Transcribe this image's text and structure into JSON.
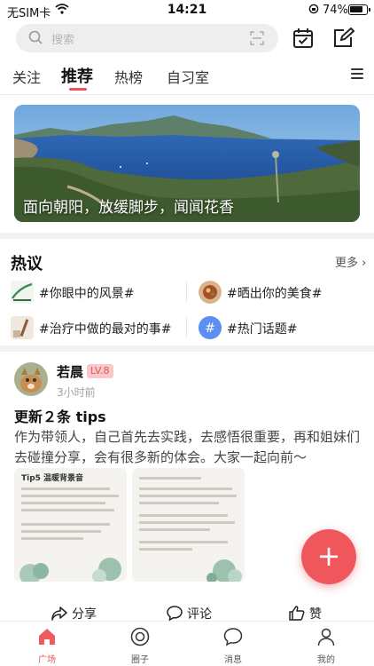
{
  "status_bar": {
    "carrier": "无SIM卡",
    "time": "14:21",
    "battery": "74%"
  },
  "search": {
    "placeholder": "搜索"
  },
  "tabs": [
    {
      "label": "关注",
      "active": false
    },
    {
      "label": "推荐",
      "active": true
    },
    {
      "label": "热榜",
      "active": false
    },
    {
      "label": "自习室",
      "active": false
    }
  ],
  "banner": {
    "caption": "面向朝阳，放缓脚步，闻闻花香"
  },
  "hot": {
    "title": "热议",
    "more": "更多",
    "topics": [
      {
        "label": "#你眼中的风景#",
        "icon": "landscape-thumbnail-icon"
      },
      {
        "label": "#晒出你的美食#",
        "icon": "food-thumbnail-icon"
      },
      {
        "label": "#治疗中做的最对的事#",
        "icon": "treatment-thumbnail-icon"
      },
      {
        "label": "#热门话题#",
        "icon": "hashtag-icon"
      }
    ]
  },
  "post": {
    "username": "若晨",
    "level": "LV.8",
    "time": "3小时前",
    "title": "更新２条 tips",
    "body": "作为带领人，自己首先去实践，去感悟很重要，再和姐妹们去碰撞分享，会有很多新的体会。大家一起向前～",
    "image1_title": "Tip5 温暖背景音",
    "actions": {
      "share": "分享",
      "comment": "评论",
      "like": "赞"
    }
  },
  "bottom_nav": [
    {
      "label": "广场",
      "icon": "home-icon",
      "active": true
    },
    {
      "label": "圈子",
      "icon": "circle-icon",
      "active": false
    },
    {
      "label": "消息",
      "icon": "message-icon",
      "active": false
    },
    {
      "label": "我的",
      "icon": "profile-icon",
      "active": false
    }
  ],
  "colors": {
    "accent": "#e9535a",
    "fab": "#f0575c"
  }
}
